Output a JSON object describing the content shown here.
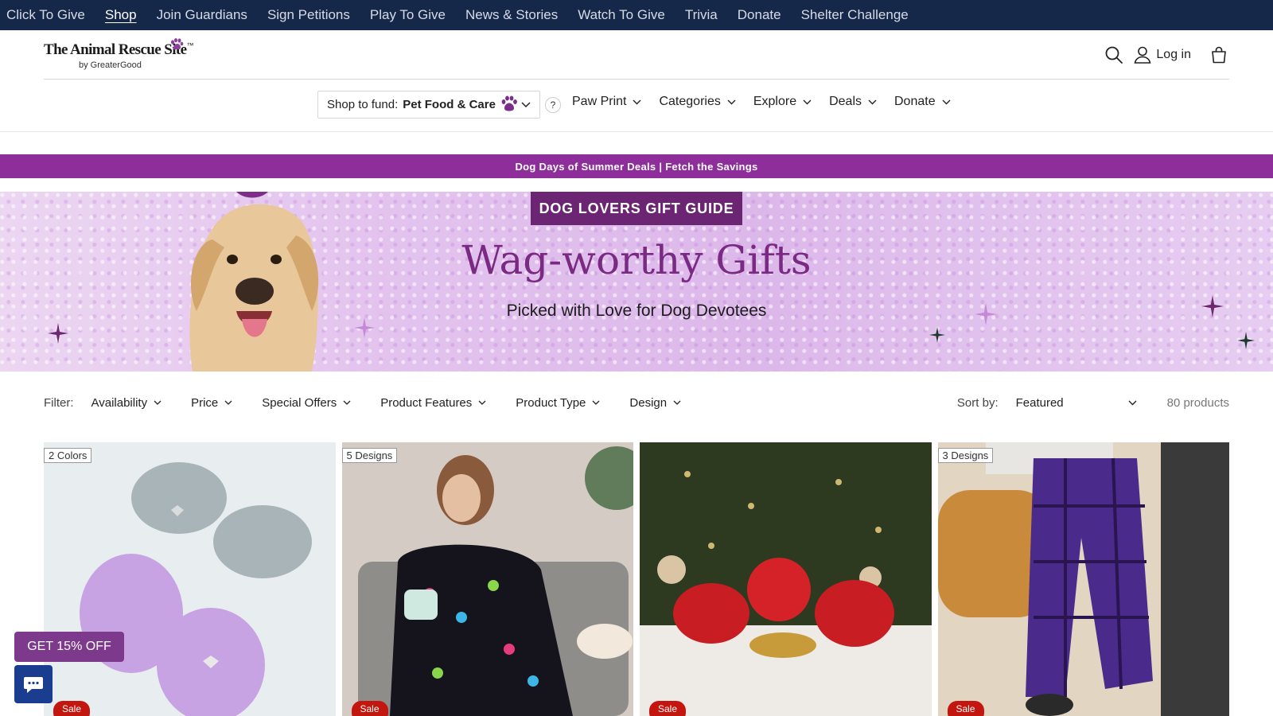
{
  "topnav": {
    "items": [
      {
        "label": "Click To Give"
      },
      {
        "label": "Shop"
      },
      {
        "label": "Join Guardians"
      },
      {
        "label": "Sign Petitions"
      },
      {
        "label": "Play To Give"
      },
      {
        "label": "News & Stories"
      },
      {
        "label": "Watch To Give"
      },
      {
        "label": "Trivia"
      },
      {
        "label": "Donate"
      },
      {
        "label": "Shelter Challenge"
      }
    ],
    "active": "Shop"
  },
  "header": {
    "logo_main": "The Animal Rescue Site",
    "logo_tm": "™",
    "logo_sub": "by GreaterGood",
    "login_label": "Log in"
  },
  "subnav": {
    "fund_label": "Shop to fund:",
    "fund_value": "Pet Food & Care",
    "help": "?",
    "menu": [
      {
        "label": "Paw Print"
      },
      {
        "label": "Categories"
      },
      {
        "label": "Explore"
      },
      {
        "label": "Deals"
      },
      {
        "label": "Donate"
      }
    ]
  },
  "promo": {
    "text": "Dog Days of Summer Deals | Fetch the Savings"
  },
  "hero": {
    "badge": "DOG LOVERS GIFT GUIDE",
    "title": "Wag-worthy Gifts",
    "subtitle": "Picked with Love for Dog Devotees"
  },
  "filters": {
    "label": "Filter:",
    "items": [
      {
        "label": "Availability"
      },
      {
        "label": "Price"
      },
      {
        "label": "Special Offers"
      },
      {
        "label": "Product Features"
      },
      {
        "label": "Product Type"
      },
      {
        "label": "Design"
      }
    ],
    "sort_label": "Sort by:",
    "sort_value": "Featured",
    "count": "80 products"
  },
  "products": [
    {
      "tag": "2 Colors",
      "sale": "Sale"
    },
    {
      "tag": "5 Designs",
      "sale": "Sale"
    },
    {
      "tag": "",
      "sale": "Sale"
    },
    {
      "tag": "3 Designs",
      "sale": "Sale"
    }
  ],
  "widgets": {
    "discount": "GET 15% OFF"
  },
  "colors": {
    "topnav_bg": "#16284a",
    "promo_bg": "#8d2e9a",
    "badge_bg": "#6c2573",
    "title_color": "#7a2a83",
    "sale_red": "#c3160f",
    "chat_blue": "#1a3d8f"
  }
}
